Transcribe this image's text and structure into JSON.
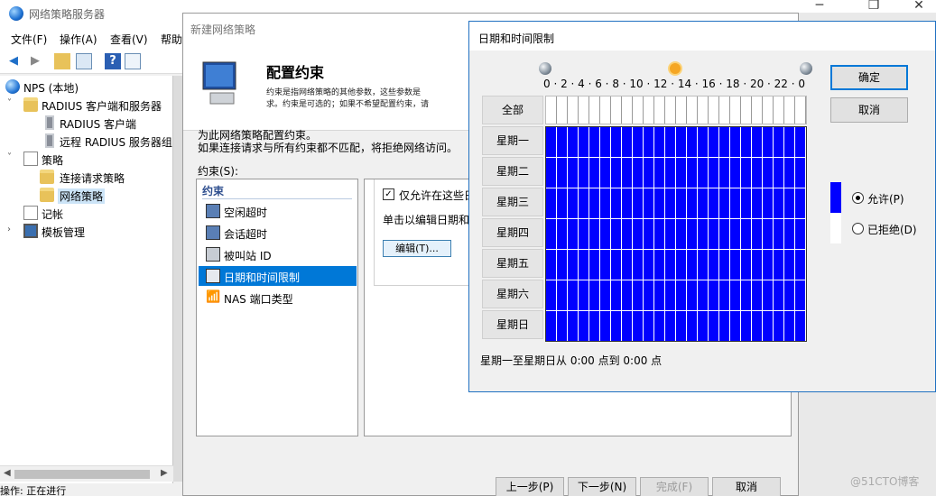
{
  "nps": {
    "title": "网络策略服务器",
    "menu": [
      "文件(F)",
      "操作(A)",
      "查看(V)",
      "帮助"
    ],
    "tree": {
      "root": "NPS (本地)",
      "radius_group": "RADIUS 客户端和服务器",
      "radius_clients": "RADIUS 客户端",
      "remote_radius": "远程 RADIUS 服务器组",
      "policies": "策略",
      "connection_request": "连接请求策略",
      "network_policy": "网络策略",
      "accounting": "记帐",
      "templates": "模板管理"
    },
    "status": "操作:  正在进行"
  },
  "wizard": {
    "title": "新建网络策略",
    "heading": "配置约束",
    "desc_line1": "约束是指网络策略的其他参数，这些参数是",
    "desc_line2": "求。约束是可选的；如果不希望配置约束，请",
    "intro_line1": "为此网络策略配置约束。",
    "intro_line2": "如果连接请求与所有约束都不匹配，将拒绝网络访问。",
    "constraints_label": "约束(S):",
    "list_header": "约束",
    "items": [
      "空闲超时",
      "会话超时",
      "被叫站 ID",
      "日期和时间限制",
      "NAS 端口类型"
    ],
    "checkbox_label": "仅允许在这些日",
    "click_hint": "单击以编辑日期和",
    "edit_button": "编辑(T)...",
    "buttons": {
      "prev": "上一步(P)",
      "next": "下一步(N)",
      "finish": "完成(F)",
      "cancel": "取消"
    }
  },
  "dialog": {
    "title": "日期和时间限制",
    "hour_labels": "0 · 2 · 4 · 6 · 8 · 10 · 12 · 14 · 16 · 18 · 20 · 22 · 0",
    "days": [
      "全部",
      "星期一",
      "星期二",
      "星期三",
      "星期四",
      "星期五",
      "星期六",
      "星期日"
    ],
    "ok": "确定",
    "cancel": "取消",
    "permit": "允许(P)",
    "deny": "已拒绝(D)",
    "permit_color": "#0000ff",
    "summary": "星期一至星期日从 0:00 点到 0:00 点"
  },
  "watermark": "@51CTO博客"
}
